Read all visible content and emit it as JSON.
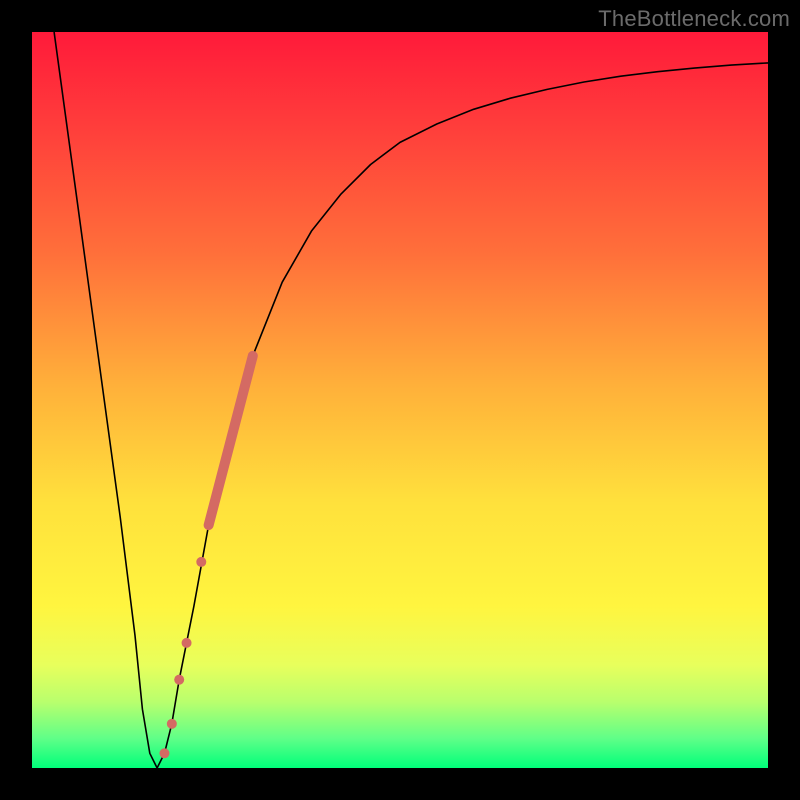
{
  "watermark": {
    "text": "TheBottleneck.com"
  },
  "colors": {
    "frame": "#000000",
    "curve": "#000000",
    "highlight": "#d46a63",
    "gradient_top": "#ff1a3a",
    "gradient_bottom": "#00ff7a"
  },
  "chart_data": {
    "type": "line",
    "title": "",
    "xlabel": "",
    "ylabel": "",
    "xlim": [
      0,
      100
    ],
    "ylim": [
      0,
      100
    ],
    "x": [
      3,
      6,
      9,
      12,
      14,
      15,
      16,
      17,
      18,
      19,
      20,
      22,
      24,
      26,
      28,
      30,
      34,
      38,
      42,
      46,
      50,
      55,
      60,
      65,
      70,
      75,
      80,
      85,
      90,
      95,
      100
    ],
    "values": [
      100,
      78,
      56,
      34,
      18,
      8,
      2,
      0,
      2,
      6,
      12,
      22,
      33,
      42,
      50,
      56,
      66,
      73,
      78,
      82,
      85,
      87.5,
      89.5,
      91,
      92.2,
      93.2,
      94,
      94.6,
      95.1,
      95.5,
      95.8
    ],
    "series": [
      {
        "name": "bottleneck-curve",
        "x": [
          3,
          6,
          9,
          12,
          14,
          15,
          16,
          17,
          18,
          19,
          20,
          22,
          24,
          26,
          28,
          30,
          34,
          38,
          42,
          46,
          50,
          55,
          60,
          65,
          70,
          75,
          80,
          85,
          90,
          95,
          100
        ],
        "y": [
          100,
          78,
          56,
          34,
          18,
          8,
          2,
          0,
          2,
          6,
          12,
          22,
          33,
          42,
          50,
          56,
          66,
          73,
          78,
          82,
          85,
          87.5,
          89.5,
          91,
          92.2,
          93.2,
          94,
          94.6,
          95.1,
          95.5,
          95.8
        ]
      }
    ],
    "highlight": {
      "segment": {
        "x_start": 24,
        "y_start": 33,
        "x_end": 30,
        "y_end": 56
      },
      "points": [
        {
          "x": 18,
          "y": 2
        },
        {
          "x": 19,
          "y": 6
        },
        {
          "x": 20,
          "y": 12
        },
        {
          "x": 21,
          "y": 17
        },
        {
          "x": 23,
          "y": 28
        }
      ]
    }
  }
}
